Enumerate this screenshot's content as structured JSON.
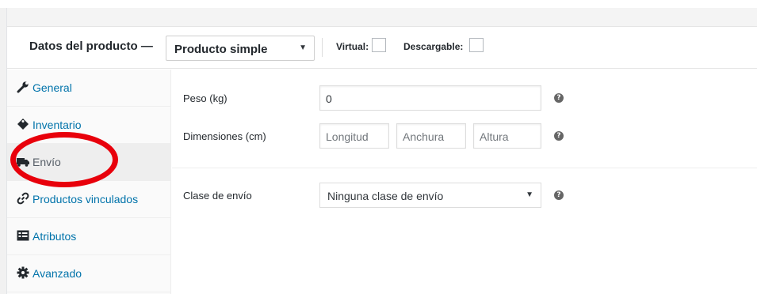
{
  "header": {
    "title": "Datos del producto —",
    "product_type": "Producto simple",
    "virtual_label": "Virtual:",
    "downloadable_label": "Descargable:"
  },
  "sidebar": {
    "items": [
      {
        "label": "General",
        "icon": "wrench-icon"
      },
      {
        "label": "Inventario",
        "icon": "tag-icon"
      },
      {
        "label": "Envío",
        "icon": "truck-icon",
        "active": true
      },
      {
        "label": "Productos vinculados",
        "icon": "link-icon"
      },
      {
        "label": "Atributos",
        "icon": "list-icon"
      },
      {
        "label": "Avanzado",
        "icon": "gear-icon"
      }
    ]
  },
  "shipping": {
    "weight_label": "Peso (kg)",
    "weight_value": "0",
    "dimensions_label": "Dimensiones (cm)",
    "length_placeholder": "Longitud",
    "width_placeholder": "Anchura",
    "height_placeholder": "Altura",
    "class_label": "Clase de envío",
    "class_value": "Ninguna clase de envío",
    "help_glyph": "?"
  },
  "colors": {
    "link": "#0073aa",
    "highlight": "#e8000b"
  }
}
